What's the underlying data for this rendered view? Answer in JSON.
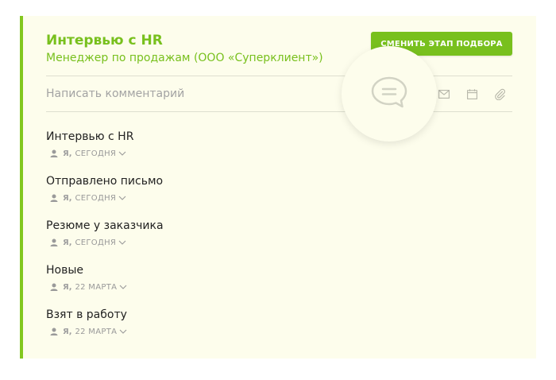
{
  "header": {
    "title": "Интервью с HR",
    "subtitle": "Менеджер по продажам (ООО «Суперклиент»)",
    "stage_button_label": "СМЕНИТЬ ЭТАП ПОДБОРА"
  },
  "comment": {
    "placeholder": "Написать комментарий"
  },
  "colors": {
    "accent": "#78c01d",
    "card_background": "#fdfdec"
  },
  "toolbar": {
    "icons": [
      "chat-bubble-icon",
      "mail-icon",
      "calendar-icon",
      "paperclip-icon"
    ]
  },
  "events": [
    {
      "title": "Интервью с HR",
      "author": "Я,",
      "date": "СЕГОДНЯ"
    },
    {
      "title": "Отправлено письмо",
      "author": "Я,",
      "date": "СЕГОДНЯ"
    },
    {
      "title": "Резюме у заказчика",
      "author": "Я,",
      "date": "СЕГОДНЯ"
    },
    {
      "title": "Новые",
      "author": "Я,",
      "date": "22 МАРТА"
    },
    {
      "title": "Взят в работу",
      "author": "Я,",
      "date": "22 МАРТА"
    }
  ]
}
